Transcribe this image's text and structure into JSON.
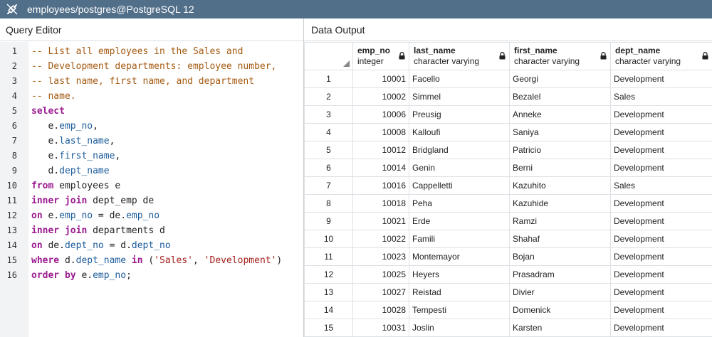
{
  "window": {
    "title": "employees/postgres@PostgreSQL 12",
    "icon": "connection-plug-icon"
  },
  "panels": {
    "query_editor_label": "Query Editor",
    "data_output_label": "Data Output"
  },
  "editor": {
    "lines": [
      [
        {
          "t": "-- List all employees in the Sales and",
          "c": "comment"
        }
      ],
      [
        {
          "t": "-- Development departments: employee number,",
          "c": "comment"
        }
      ],
      [
        {
          "t": "-- last name, first name, and department",
          "c": "comment"
        }
      ],
      [
        {
          "t": "-- name.",
          "c": "comment"
        }
      ],
      [
        {
          "t": "select",
          "c": "keyword"
        }
      ],
      [
        {
          "t": "   e.",
          "c": "plain"
        },
        {
          "t": "emp_no",
          "c": "field"
        },
        {
          "t": ",",
          "c": "plain"
        }
      ],
      [
        {
          "t": "   e.",
          "c": "plain"
        },
        {
          "t": "last_name",
          "c": "field"
        },
        {
          "t": ",",
          "c": "plain"
        }
      ],
      [
        {
          "t": "   e.",
          "c": "plain"
        },
        {
          "t": "first_name",
          "c": "field"
        },
        {
          "t": ",",
          "c": "plain"
        }
      ],
      [
        {
          "t": "   d.",
          "c": "plain"
        },
        {
          "t": "dept_name",
          "c": "field"
        }
      ],
      [
        {
          "t": "from",
          "c": "keyword"
        },
        {
          "t": " employees e",
          "c": "plain"
        }
      ],
      [
        {
          "t": "inner join",
          "c": "keyword"
        },
        {
          "t": " dept_emp de",
          "c": "plain"
        }
      ],
      [
        {
          "t": "on",
          "c": "keyword"
        },
        {
          "t": " e.",
          "c": "plain"
        },
        {
          "t": "emp_no",
          "c": "field"
        },
        {
          "t": " = de.",
          "c": "plain"
        },
        {
          "t": "emp_no",
          "c": "field"
        }
      ],
      [
        {
          "t": "inner join",
          "c": "keyword"
        },
        {
          "t": " departments d",
          "c": "plain"
        }
      ],
      [
        {
          "t": "on",
          "c": "keyword"
        },
        {
          "t": " de.",
          "c": "plain"
        },
        {
          "t": "dept_no",
          "c": "field"
        },
        {
          "t": " = d.",
          "c": "plain"
        },
        {
          "t": "dept_no",
          "c": "field"
        }
      ],
      [
        {
          "t": "where",
          "c": "keyword"
        },
        {
          "t": " d.",
          "c": "plain"
        },
        {
          "t": "dept_name",
          "c": "field"
        },
        {
          "t": " ",
          "c": "plain"
        },
        {
          "t": "in",
          "c": "keyword"
        },
        {
          "t": " (",
          "c": "plain"
        },
        {
          "t": "'Sales'",
          "c": "string"
        },
        {
          "t": ", ",
          "c": "plain"
        },
        {
          "t": "'Development'",
          "c": "string"
        },
        {
          "t": ")",
          "c": "plain"
        }
      ],
      [
        {
          "t": "order by",
          "c": "keyword"
        },
        {
          "t": " e.",
          "c": "plain"
        },
        {
          "t": "emp_no",
          "c": "field"
        },
        {
          "t": ";",
          "c": "plain"
        }
      ]
    ]
  },
  "grid": {
    "columns": [
      {
        "name": "emp_no",
        "type": "integer",
        "locked": true
      },
      {
        "name": "last_name",
        "type": "character varying",
        "locked": true
      },
      {
        "name": "first_name",
        "type": "character varying",
        "locked": true
      },
      {
        "name": "dept_name",
        "type": "character varying",
        "locked": true
      }
    ],
    "rows": [
      [
        "1",
        "10001",
        "Facello",
        "Georgi",
        "Development"
      ],
      [
        "2",
        "10002",
        "Simmel",
        "Bezalel",
        "Sales"
      ],
      [
        "3",
        "10006",
        "Preusig",
        "Anneke",
        "Development"
      ],
      [
        "4",
        "10008",
        "Kalloufi",
        "Saniya",
        "Development"
      ],
      [
        "5",
        "10012",
        "Bridgland",
        "Patricio",
        "Development"
      ],
      [
        "6",
        "10014",
        "Genin",
        "Berni",
        "Development"
      ],
      [
        "7",
        "10016",
        "Cappelletti",
        "Kazuhito",
        "Sales"
      ],
      [
        "8",
        "10018",
        "Peha",
        "Kazuhide",
        "Development"
      ],
      [
        "9",
        "10021",
        "Erde",
        "Ramzi",
        "Development"
      ],
      [
        "10",
        "10022",
        "Famili",
        "Shahaf",
        "Development"
      ],
      [
        "11",
        "10023",
        "Montemayor",
        "Bojan",
        "Development"
      ],
      [
        "12",
        "10025",
        "Heyers",
        "Prasadram",
        "Development"
      ],
      [
        "13",
        "10027",
        "Reistad",
        "Divier",
        "Development"
      ],
      [
        "14",
        "10028",
        "Tempesti",
        "Domenick",
        "Development"
      ],
      [
        "15",
        "10031",
        "Joslin",
        "Karsten",
        "Development"
      ]
    ]
  }
}
